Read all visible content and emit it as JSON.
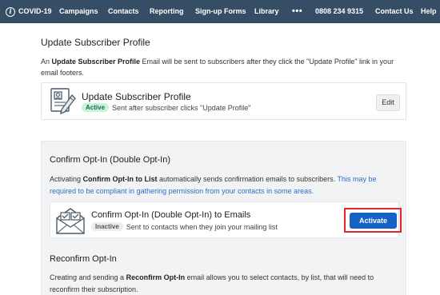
{
  "nav": {
    "covid": "COVID-19",
    "campaigns": "Campaigns",
    "contacts": "Contacts",
    "reporting": "Reporting",
    "signup_forms": "Sign-up Forms",
    "library": "Library",
    "more": "•••",
    "phone": "0808 234 9315",
    "contact_us": "Contact Us",
    "help": "Help"
  },
  "update_profile": {
    "heading": "Update Subscriber Profile",
    "desc_prefix": "An ",
    "desc_bold": "Update Subscriber Profile",
    "desc_suffix": " Email will be sent to subscribers after they click the \"Update Profile\" link in your email footers.",
    "card_title": "Update Subscriber Profile",
    "status": "Active",
    "card_sub": "Sent after subscriber clicks \"Update Profile\"",
    "edit_label": "Edit"
  },
  "confirm_optin": {
    "heading": "Confirm Opt-In (Double Opt-In)",
    "desc_prefix": "Activating ",
    "desc_bold": "Confirm Opt-In to List",
    "desc_middle": " automatically sends confirmation emails to subscribers. ",
    "desc_link": "This may be required to be compliant in gathering permission from your contacts in some areas.",
    "card_title": "Confirm Opt-In (Double Opt-In) to Emails",
    "status": "Inactive",
    "card_sub": "Sent to contacts when they join your mailing list",
    "activate_label": "Activate"
  },
  "reconfirm": {
    "heading": "Reconfirm Opt-In",
    "desc_prefix": "Creating and sending a ",
    "desc_bold": "Reconfirm Opt-In",
    "desc_suffix": " email allows you to select contacts, by list, that will need to reconfirm their subscription."
  },
  "colors": {
    "nav_bg": "#364e65",
    "primary_button": "#1462c3",
    "highlight": "#e2282d",
    "active_badge": "#c9f2dc",
    "link": "#2a6ec8"
  }
}
